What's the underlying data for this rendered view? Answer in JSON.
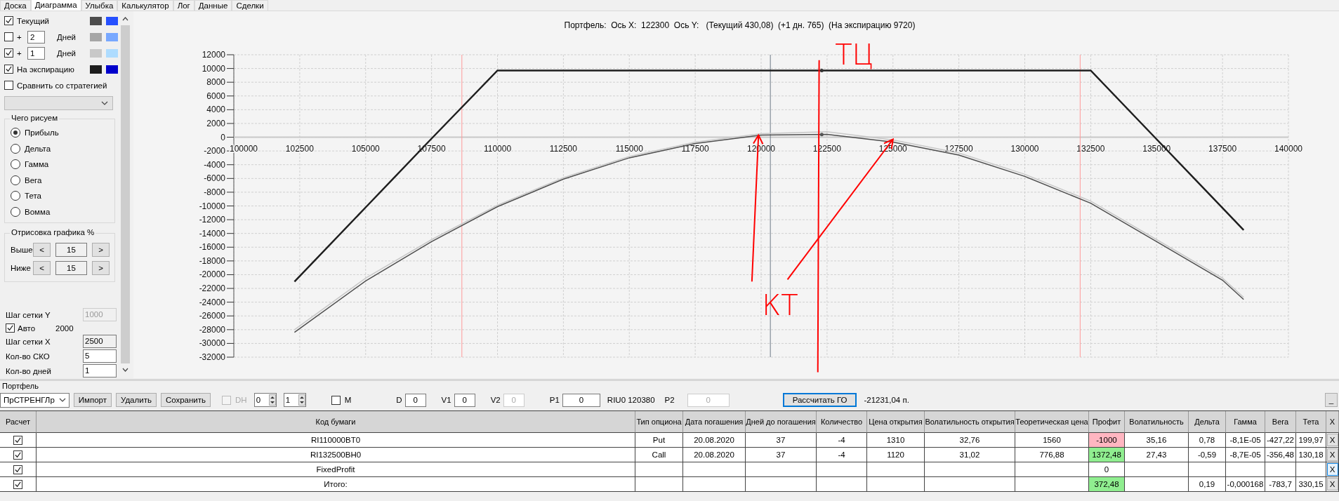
{
  "tabs": [
    {
      "label": "Доска",
      "selected": false
    },
    {
      "label": "Диаграмма",
      "selected": true
    },
    {
      "label": "Улыбка",
      "selected": false
    },
    {
      "label": "Калькулятор",
      "selected": false
    },
    {
      "label": "Лог",
      "selected": false
    },
    {
      "label": "Данные",
      "selected": false
    },
    {
      "label": "Сделки",
      "selected": false
    }
  ],
  "left_panel": {
    "curves": [
      {
        "checked": true,
        "label": "Текущий",
        "swatches": [
          {
            "color": "#4d4d4d"
          },
          {
            "color": "#2650ff"
          }
        ]
      },
      {
        "checked": false,
        "prefix": "+",
        "days": "2",
        "unit": "Дней",
        "swatches": [
          {
            "color": "#a6a6a6"
          },
          {
            "color": "#78a8ff"
          }
        ]
      },
      {
        "checked": true,
        "prefix": "+",
        "days": "1",
        "unit": "Дней",
        "swatches": [
          {
            "color": "#c8c8c8"
          },
          {
            "color": "#aedcff"
          }
        ]
      },
      {
        "checked": true,
        "label": "На экспирацию",
        "swatches": [
          {
            "color": "#1e1e1e"
          },
          {
            "color": "#0000cc"
          }
        ]
      }
    ],
    "compare": {
      "checked": false,
      "label": "Сравнить со стратегией"
    },
    "strategy_select": {
      "disabled": true
    },
    "draw_group": {
      "title": "Чего рисуем",
      "options": [
        {
          "label": "Прибыль",
          "selected": true
        },
        {
          "label": "Дельта",
          "selected": false
        },
        {
          "label": "Гамма",
          "selected": false
        },
        {
          "label": "Вега",
          "selected": false
        },
        {
          "label": "Тета",
          "selected": false
        },
        {
          "label": "Вомма",
          "selected": false
        }
      ]
    },
    "range_group": {
      "title": "Отрисовка графика %",
      "rows": [
        {
          "label": "Выше",
          "dec": "<",
          "value": "15",
          "inc": ">"
        },
        {
          "label": "Ниже",
          "dec": "<",
          "value": "15",
          "inc": ">"
        }
      ]
    },
    "grid": {
      "y_label": "Шаг сетки Y",
      "y_value": "1000",
      "y_disabled": true,
      "auto_checked": true,
      "auto_label": "Авто",
      "auto_value": "2000",
      "x_label": "Шаг сетки X",
      "x_value": "2500",
      "sko_label": "Кол-во СКО",
      "sko_value": "5",
      "days_label": "Кол-во дней",
      "days_value": "1"
    }
  },
  "chart": {
    "title": "Портфель:  Ось X:  122300  Ось Y:   (Текущий 430,08)  (+1 дн. 765)  (На экспирацию 9720)",
    "chart_data": {
      "type": "line",
      "grid": true,
      "x": [
        102300,
        105000,
        107500,
        110000,
        112500,
        115000,
        117500,
        120000,
        122500,
        125000,
        127500,
        130000,
        132500,
        135000,
        137500,
        138300
      ],
      "series": [
        {
          "color": "#4d4d4d",
          "values": [
            -28400,
            -20900,
            -15200,
            -10100,
            -6100,
            -3000,
            -900,
            300,
            400,
            -700,
            -2600,
            -5700,
            -9600,
            -15200,
            -20800,
            -23600
          ]
        },
        {
          "color": "#c8c8c8",
          "values": [
            -28000,
            -20500,
            -14900,
            -9900,
            -5900,
            -2800,
            -700,
            500,
            800,
            -400,
            -2300,
            -5400,
            -9300,
            -14900,
            -20500,
            -23300
          ]
        },
        {
          "color": "#1e1e1e",
          "values": [
            -21000,
            -10200,
            -200,
            9700,
            9700,
            9700,
            9700,
            9700,
            9700,
            9700,
            9700,
            9700,
            9700,
            -300,
            -10300,
            -13500
          ]
        }
      ],
      "xlim": [
        100000,
        140000
      ],
      "ylim": [
        -32000,
        12000
      ],
      "xticks": [
        100000,
        102500,
        105000,
        107500,
        110000,
        112500,
        115000,
        117500,
        120000,
        122500,
        125000,
        127500,
        130000,
        132500,
        135000,
        137500,
        140000
      ],
      "yticks": [
        12000,
        10000,
        8000,
        6000,
        4000,
        2000,
        0,
        -2000,
        -4000,
        -6000,
        -8000,
        -10000,
        -12000,
        -14000,
        -16000,
        -18000,
        -20000,
        -22000,
        -24000,
        -26000,
        -28000,
        -30000,
        -32000
      ],
      "ref_lines": [
        {
          "axis": "x",
          "value": 108650,
          "color": "#ff9999"
        },
        {
          "axis": "x",
          "value": 132100,
          "color": "#ff9999"
        },
        {
          "axis": "x",
          "value": 120350,
          "color": "#6e7a88"
        }
      ],
      "annotations": [
        "ТЦ",
        "КТ"
      ]
    }
  },
  "portfolio": {
    "title": "Портфель",
    "toolbar": [
      {
        "kind": "combo",
        "value": "ПрСТРЕНГЛр"
      },
      {
        "kind": "button",
        "label": "Импорт",
        "focused": false
      },
      {
        "kind": "button",
        "label": "Удалить",
        "focused": false
      },
      {
        "kind": "button",
        "label": "Сохранить",
        "focused": false
      },
      {
        "kind": "checkbox",
        "label": "DH",
        "checked": false,
        "disabled": true
      },
      {
        "kind": "spinner",
        "value": "0"
      },
      {
        "kind": "spinner",
        "value": "1"
      },
      {
        "kind": "checkbox",
        "label": "M",
        "checked": false,
        "disabled": false
      },
      {
        "kind": "field",
        "label": "D",
        "value": "0",
        "disabled": false
      },
      {
        "kind": "field",
        "label": "V1",
        "value": "0",
        "disabled": false
      },
      {
        "kind": "field",
        "label": "V2",
        "value": "0",
        "disabled": true
      },
      {
        "kind": "field",
        "label": "P1",
        "value": "0",
        "disabled": false
      },
      {
        "kind": "text",
        "text": "RIU0 120380"
      },
      {
        "kind": "field",
        "label": "P2",
        "value": "0",
        "disabled": true
      },
      {
        "kind": "button",
        "label": "Рассчитать ГО",
        "focused": true
      },
      {
        "kind": "text",
        "text": "-21231,04 п."
      },
      {
        "kind": "minimize",
        "label": "_"
      }
    ],
    "table": {
      "columns": [
        {
          "title": "Расчет",
          "kind": "check"
        },
        {
          "title": "Код бумаги"
        },
        {
          "title": "Тип опциона"
        },
        {
          "title": "Дата погашения"
        },
        {
          "title": "Дней до погашения"
        },
        {
          "title": "Количество"
        },
        {
          "title": "Цена открытия"
        },
        {
          "title": "Волатильность открытия"
        },
        {
          "title": "Теоретическая цена"
        },
        {
          "title": "Профит",
          "kind": "profit"
        },
        {
          "title": "Волатильность"
        },
        {
          "title": "Дельта"
        },
        {
          "title": "Гамма"
        },
        {
          "title": "Вега"
        },
        {
          "title": "Тета"
        },
        {
          "title": "X",
          "kind": "delete"
        }
      ],
      "rows": [
        {
          "checked": true,
          "cells": [
            "",
            "RI110000BT0",
            "Put",
            "20.08.2020",
            "37",
            "-4",
            "1310",
            "32,76",
            "1560",
            "-1000",
            "35,16",
            "0,78",
            "-8,1E-05",
            "-427,22",
            "199,97",
            "X"
          ],
          "color": "#ffb6c1",
          "focused": false
        },
        {
          "checked": true,
          "cells": [
            "",
            "RI132500BH0",
            "Call",
            "20.08.2020",
            "37",
            "-4",
            "1120",
            "31,02",
            "776,88",
            "1372,48",
            "27,43",
            "-0,59",
            "-8,7E-05",
            "-356,48",
            "130,18",
            "X"
          ],
          "color": "#90ee90",
          "focused": false
        },
        {
          "checked": true,
          "cells": [
            "",
            "FixedProfit",
            "",
            "",
            "",
            "",
            "",
            "",
            "",
            "0",
            "",
            "",
            "",
            "",
            "",
            "X"
          ],
          "focused": true
        },
        {
          "checked": true,
          "cells": [
            "",
            "Итого:",
            "",
            "",
            "",
            "",
            "",
            "",
            "",
            "372,48",
            "",
            "0,19",
            "-0,000168",
            "-783,7",
            "330,15",
            "X"
          ],
          "color": "#90ee90",
          "focused": false
        }
      ]
    }
  }
}
